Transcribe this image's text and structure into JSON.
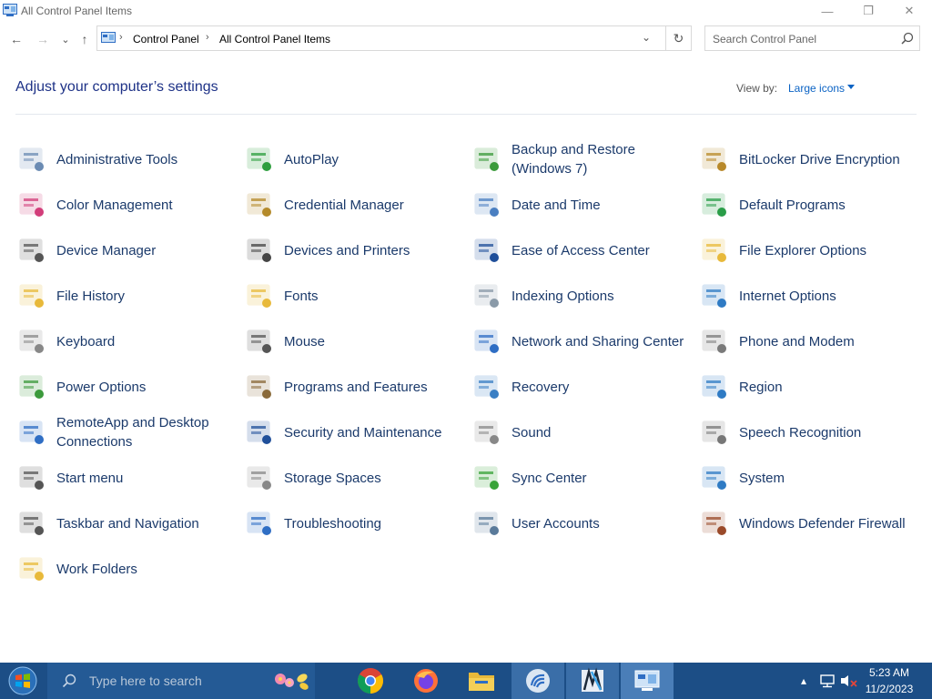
{
  "window": {
    "title": "All Control Panel Items",
    "controls": {
      "minimize": "—",
      "maximize": "❐",
      "close": "✕"
    }
  },
  "nav": {
    "back_icon": "←",
    "forward_icon": "→",
    "recent_icon": "⌄",
    "up_icon": "↑",
    "breadcrumb": [
      "Control Panel",
      "All Control Panel Items"
    ],
    "refresh_icon": "↻",
    "search_placeholder": "Search Control Panel"
  },
  "header": {
    "title": "Adjust your computer’s settings",
    "view_by_label": "View by:",
    "view_mode": "Large icons"
  },
  "items": [
    {
      "label": "Administrative Tools",
      "icon": "admin-tools-icon",
      "color": "#6b8bb3"
    },
    {
      "label": "AutoPlay",
      "icon": "autoplay-icon",
      "color": "#2e9e3e"
    },
    {
      "label": "Backup and Restore (Windows 7)",
      "icon": "backup-icon",
      "color": "#3a9a3a"
    },
    {
      "label": "BitLocker Drive Encryption",
      "icon": "bitlocker-icon",
      "color": "#b8892a"
    },
    {
      "label": "Color Management",
      "icon": "color-management-icon",
      "color": "#d23d7a"
    },
    {
      "label": "Credential Manager",
      "icon": "credential-icon",
      "color": "#b48a2a"
    },
    {
      "label": "Date and Time",
      "icon": "date-time-icon",
      "color": "#4a7fc1"
    },
    {
      "label": "Default Programs",
      "icon": "default-programs-icon",
      "color": "#2a9d48"
    },
    {
      "label": "Device Manager",
      "icon": "device-manager-icon",
      "color": "#555555"
    },
    {
      "label": "Devices and Printers",
      "icon": "printer-icon",
      "color": "#444444"
    },
    {
      "label": "Ease of Access Center",
      "icon": "ease-of-access-icon",
      "color": "#1f4f9a"
    },
    {
      "label": "File Explorer Options",
      "icon": "folder-options-icon",
      "color": "#e8b93a"
    },
    {
      "label": "File History",
      "icon": "file-history-icon",
      "color": "#e8b93a"
    },
    {
      "label": "Fonts",
      "icon": "fonts-icon",
      "color": "#e8b93a"
    },
    {
      "label": "Indexing Options",
      "icon": "indexing-icon",
      "color": "#8a9aa8"
    },
    {
      "label": "Internet Options",
      "icon": "internet-options-icon",
      "color": "#2f7bc4"
    },
    {
      "label": "Keyboard",
      "icon": "keyboard-icon",
      "color": "#888888"
    },
    {
      "label": "Mouse",
      "icon": "mouse-icon",
      "color": "#555555"
    },
    {
      "label": "Network and Sharing Center",
      "icon": "network-icon",
      "color": "#2f6ec4"
    },
    {
      "label": "Phone and Modem",
      "icon": "phone-icon",
      "color": "#7a7a7a"
    },
    {
      "label": "Power Options",
      "icon": "power-icon",
      "color": "#3c9a3c"
    },
    {
      "label": "Programs and Features",
      "icon": "programs-icon",
      "color": "#8a6a3a"
    },
    {
      "label": "Recovery",
      "icon": "recovery-icon",
      "color": "#3a7fc4"
    },
    {
      "label": "Region",
      "icon": "region-icon",
      "color": "#2f7bc4"
    },
    {
      "label": "RemoteApp and Desktop Connections",
      "icon": "remoteapp-icon",
      "color": "#2f6ec4"
    },
    {
      "label": "Security and Maintenance",
      "icon": "security-flag-icon",
      "color": "#1f4f9a"
    },
    {
      "label": "Sound",
      "icon": "sound-icon",
      "color": "#888888"
    },
    {
      "label": "Speech Recognition",
      "icon": "microphone-icon",
      "color": "#777777"
    },
    {
      "label": "Start menu",
      "icon": "start-menu-icon",
      "color": "#555555"
    },
    {
      "label": "Storage Spaces",
      "icon": "storage-icon",
      "color": "#888888"
    },
    {
      "label": "Sync Center",
      "icon": "sync-icon",
      "color": "#3aa33a"
    },
    {
      "label": "System",
      "icon": "system-icon",
      "color": "#2f7bc4"
    },
    {
      "label": "Taskbar and Navigation",
      "icon": "taskbar-icon",
      "color": "#555555"
    },
    {
      "label": "Troubleshooting",
      "icon": "troubleshooting-icon",
      "color": "#2f6ec4"
    },
    {
      "label": "User Accounts",
      "icon": "user-accounts-icon",
      "color": "#5a7a9a"
    },
    {
      "label": "Windows Defender Firewall",
      "icon": "firewall-icon",
      "color": "#9a4a2a"
    },
    {
      "label": "Work Folders",
      "icon": "work-folders-icon",
      "color": "#e8b93a"
    }
  ],
  "taskbar": {
    "search_placeholder": "Type here to search",
    "apps": [
      {
        "name": "chrome-icon"
      },
      {
        "name": "firefox-icon"
      },
      {
        "name": "file-explorer-icon"
      },
      {
        "name": "app-icon"
      },
      {
        "name": "app-icon-2"
      },
      {
        "name": "control-panel-icon"
      }
    ],
    "time": "5:23 AM",
    "date": "11/2/2023"
  }
}
